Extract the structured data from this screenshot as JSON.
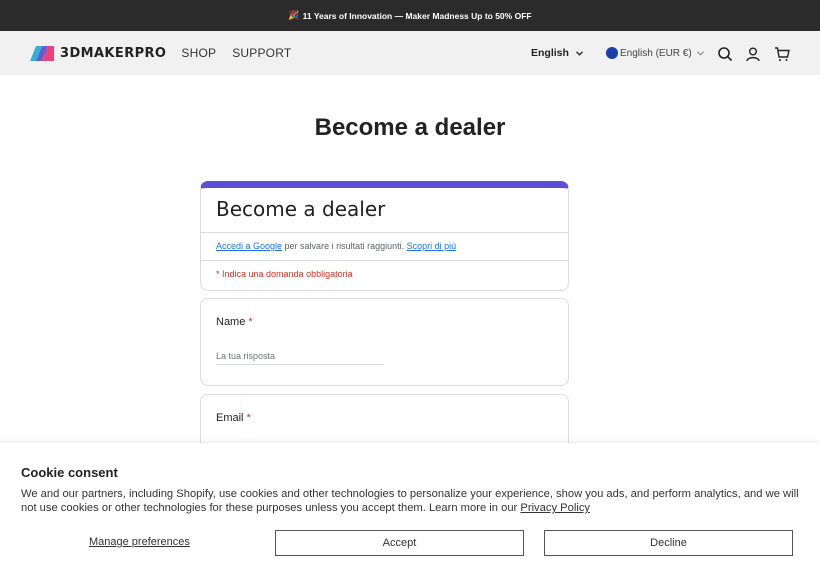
{
  "announcement": {
    "emoji": "🎉",
    "text": "11 Years of Innovation — Maker Madness Up to 50% OFF"
  },
  "header": {
    "logo_text": "3DMAKERPRO",
    "nav": [
      "SHOP",
      "SUPPORT"
    ],
    "language": "English",
    "currency": "English (EUR €)"
  },
  "page": {
    "title": "Become a dealer"
  },
  "form": {
    "title": "Become a dealer",
    "signin_link": "Accedi a Google",
    "signin_text": " per salvare i risultati raggiunti. ",
    "learn_more": "Scopri di più",
    "required_note": "* Indica una domanda obbligatoria",
    "questions": [
      {
        "label": "Name",
        "required": "*",
        "placeholder": "La tua risposta"
      },
      {
        "label": "Email",
        "required": "*"
      }
    ]
  },
  "cookie": {
    "title": "Cookie consent",
    "text": "We and our partners, including Shopify, use cookies and other technologies to personalize your experience, show you ads, and perform analytics, and we will not use cookies or other technologies for these purposes unless you accept them. Learn more in our ",
    "policy_link": "Privacy Policy",
    "manage": "Manage preferences",
    "accept": "Accept",
    "decline": "Decline"
  },
  "colors": {
    "accent": "#5b4fd6",
    "required": "#d93025",
    "link": "#1a73e8"
  },
  "icons": [
    "search-icon",
    "account-icon",
    "cart-icon",
    "chevron-down-icon"
  ]
}
